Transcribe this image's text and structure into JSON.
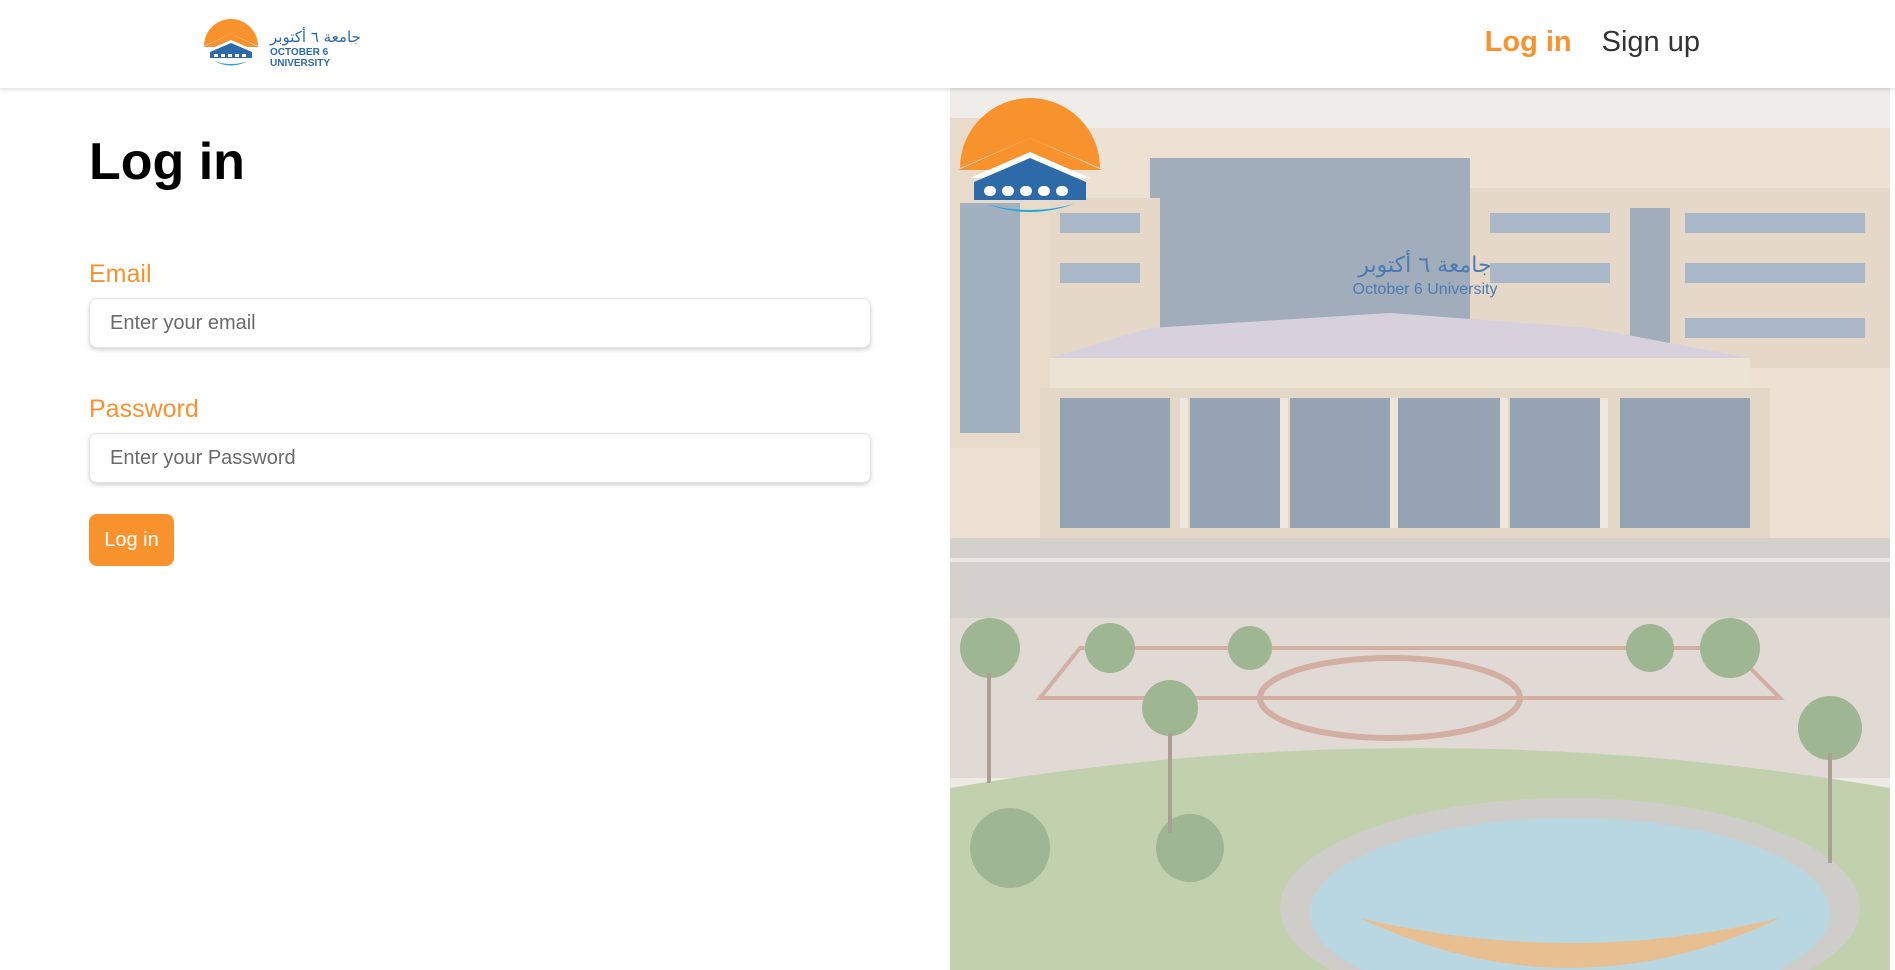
{
  "header": {
    "logo": {
      "arabic_text": "جامعة ٦ أكتوبر",
      "english_text": "OCTOBER 6 UNIVERSITY"
    },
    "nav": {
      "login_label": "Log in",
      "signup_label": "Sign up"
    }
  },
  "form": {
    "title": "Log in",
    "email": {
      "label": "Email",
      "placeholder": "Enter your email",
      "value": ""
    },
    "password": {
      "label": "Password",
      "placeholder": "Enter your Password",
      "value": ""
    },
    "submit_label": "Log in"
  },
  "hero": {
    "logo_arabic": "جامعة ٦ أكتوبر",
    "logo_english": "October 6 University"
  },
  "colors": {
    "accent": "#f7922d",
    "brand_blue": "#2c6aa8",
    "text": "#000000"
  },
  "icons": {
    "logo": "university-logo-icon"
  }
}
